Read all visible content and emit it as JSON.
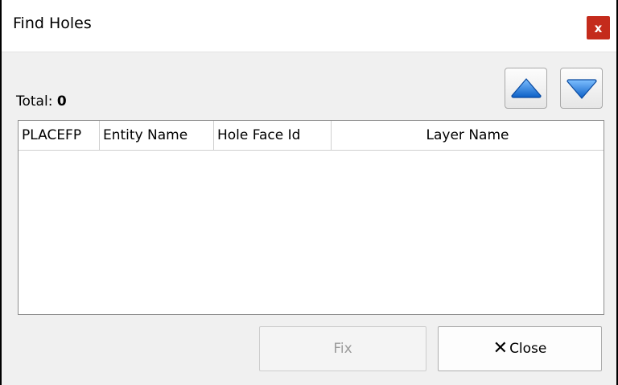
{
  "window": {
    "title": "Find Holes",
    "close_glyph": "x"
  },
  "summary": {
    "total_label": "Total:",
    "total_value": "0"
  },
  "toolbar": {
    "up_icon": "triangle-up-icon",
    "down_icon": "triangle-down-icon",
    "accent": "#1e73d2"
  },
  "table": {
    "columns": [
      "PLACEFP",
      "Entity Name",
      "Hole Face Id",
      "Layer Name"
    ],
    "rows": []
  },
  "buttons": {
    "fix_label": "Fix",
    "close_label": "Close",
    "close_icon": "x-icon"
  }
}
